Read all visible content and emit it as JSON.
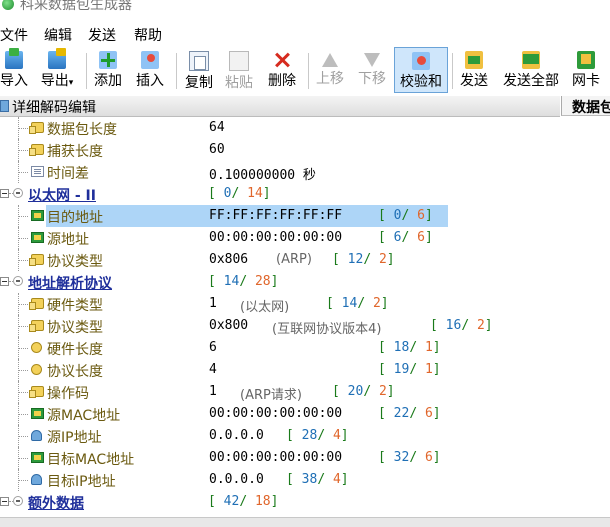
{
  "window": {
    "title": "科来数据包生成器"
  },
  "menu": [
    "文件",
    "编辑",
    "发送",
    "帮助"
  ],
  "toolbar": {
    "import": "导入",
    "export": "导出",
    "add": "添加",
    "insert": "插入",
    "copy": "复制",
    "paste": "粘贴",
    "delete": "删除",
    "up": "上移",
    "down": "下移",
    "checksum": "校验和",
    "send": "发送",
    "send_all": "发送全部",
    "nic": "网卡"
  },
  "panel": {
    "title": "详细解码编辑",
    "right_tab": "数据包"
  },
  "tree": [
    {
      "name": "数据包长度",
      "value": "64",
      "icon": "field-icon"
    },
    {
      "name": "捕获长度",
      "value": "60",
      "icon": "field-icon"
    },
    {
      "name": "时间差",
      "value": "0.100000000 秒",
      "icon": "clock-icon"
    },
    {
      "name": "以太网 - II",
      "group": true,
      "range_a": "0",
      "range_b": "14"
    },
    {
      "name": "目的地址",
      "value": "FF:FF:FF:FF:FF:FF",
      "range_a": "0",
      "range_b": "6",
      "selected": true,
      "icon": "mac-icon"
    },
    {
      "name": "源地址",
      "value": "00:00:00:00:00:00",
      "range_a": "6",
      "range_b": "6",
      "icon": "mac-icon"
    },
    {
      "name": "协议类型",
      "value": "0x806",
      "desc": "(ARP)",
      "range_a": "12",
      "range_b": "2",
      "icon": "field-icon"
    },
    {
      "name": "地址解析协议",
      "group": true,
      "range_a": "14",
      "range_b": "28"
    },
    {
      "name": "硬件类型",
      "value": "1",
      "desc": "(以太网)",
      "range_a": "14",
      "range_b": "2",
      "icon": "field-icon"
    },
    {
      "name": "协议类型",
      "value": "0x800",
      "desc": "(互联网协议版本4)",
      "range_a": "16",
      "range_b": "2",
      "icon": "field-icon"
    },
    {
      "name": "硬件长度",
      "value": "6",
      "range_a": "18",
      "range_b": "1",
      "icon": "coin-icon"
    },
    {
      "name": "协议长度",
      "value": "4",
      "range_a": "19",
      "range_b": "1",
      "icon": "coin-icon"
    },
    {
      "name": "操作码",
      "value": "1",
      "desc": "(ARP请求)",
      "range_a": "20",
      "range_b": "2",
      "icon": "field-icon"
    },
    {
      "name": "源MAC地址",
      "value": "00:00:00:00:00:00",
      "range_a": "22",
      "range_b": "6",
      "icon": "mac-icon"
    },
    {
      "name": "源IP地址",
      "value": "0.0.0.0",
      "range_a": "28",
      "range_b": "4",
      "icon": "ip-icon"
    },
    {
      "name": "目标MAC地址",
      "value": "00:00:00:00:00:00",
      "range_a": "32",
      "range_b": "6",
      "icon": "mac-icon"
    },
    {
      "name": "目标IP地址",
      "value": "0.0.0.0",
      "range_a": "38",
      "range_b": "4",
      "icon": "ip-icon"
    },
    {
      "name": "额外数据",
      "group": true,
      "range_a": "42",
      "range_b": "18"
    }
  ]
}
